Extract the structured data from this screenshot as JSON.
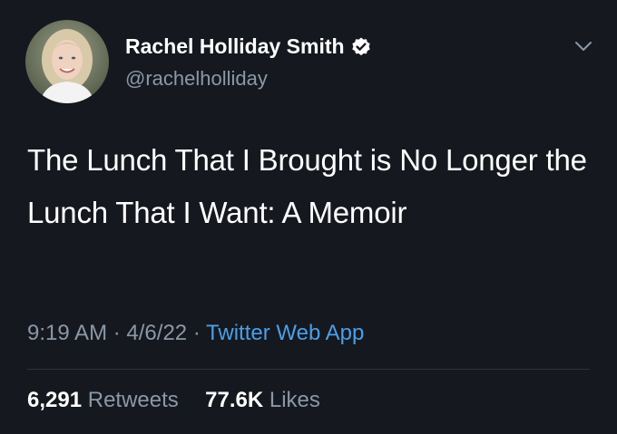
{
  "author": {
    "display_name": "Rachel Holliday Smith",
    "handle": "@rachelholliday",
    "verified": true,
    "avatar_icon": "profile-photo"
  },
  "tweet": {
    "text": "The Lunch That I Brought is No Longer the Lunch That I Want: A Memoir"
  },
  "meta": {
    "time": "9:19 AM",
    "separator": "·",
    "date": "4/6/22",
    "source": "Twitter Web App"
  },
  "stats": {
    "retweets_count": "6,291",
    "retweets_label": "Retweets",
    "likes_count": "77.6K",
    "likes_label": "Likes"
  },
  "colors": {
    "background": "#15181f",
    "text_primary": "#ffffff",
    "text_secondary": "#8b98a5",
    "link": "#4a9fe8",
    "verified_badge": "#ffffff"
  },
  "icons": {
    "verified": "verified-badge-icon",
    "menu": "chevron-down-icon"
  }
}
